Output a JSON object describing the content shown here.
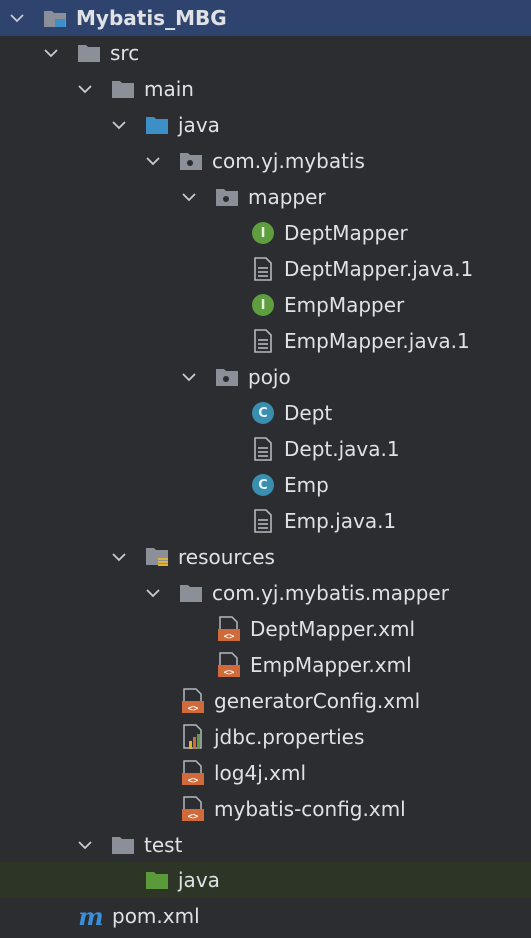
{
  "project": {
    "name": "Mybatis_MBG"
  },
  "tree": {
    "src": "src",
    "main": "main",
    "java": "java",
    "package": "com.yj.mybatis",
    "mapper": "mapper",
    "dept_mapper": "DeptMapper",
    "dept_mapper_java1": "DeptMapper.java.1",
    "emp_mapper": "EmpMapper",
    "emp_mapper_java1": "EmpMapper.java.1",
    "pojo": "pojo",
    "dept": "Dept",
    "dept_java1": "Dept.java.1",
    "emp": "Emp",
    "emp_java1": "Emp.java.1",
    "resources": "resources",
    "res_package": "com.yj.mybatis.mapper",
    "dept_mapper_xml": "DeptMapper.xml",
    "emp_mapper_xml": "EmpMapper.xml",
    "generator_config": "generatorConfig.xml",
    "jdbc_properties": "jdbc.properties",
    "log4j": "log4j.xml",
    "mybatis_config": "mybatis-config.xml",
    "test": "test",
    "test_java": "java",
    "pom": "pom.xml"
  },
  "icons": {
    "interface_letter": "I",
    "class_letter": "C",
    "maven_letter": "m"
  },
  "colors": {
    "background": "#2b2d30",
    "selected_row": "#2e436e",
    "test_java_row": "#2d3626",
    "folder": "#8a8f98",
    "source_folder": "#3d8fc8",
    "test_folder": "#5a9a3a",
    "xml_icon": "#d06a3a",
    "interface_icon": "#5e9e3e",
    "class_icon": "#3a8eae",
    "maven": "#3b8fd9"
  }
}
